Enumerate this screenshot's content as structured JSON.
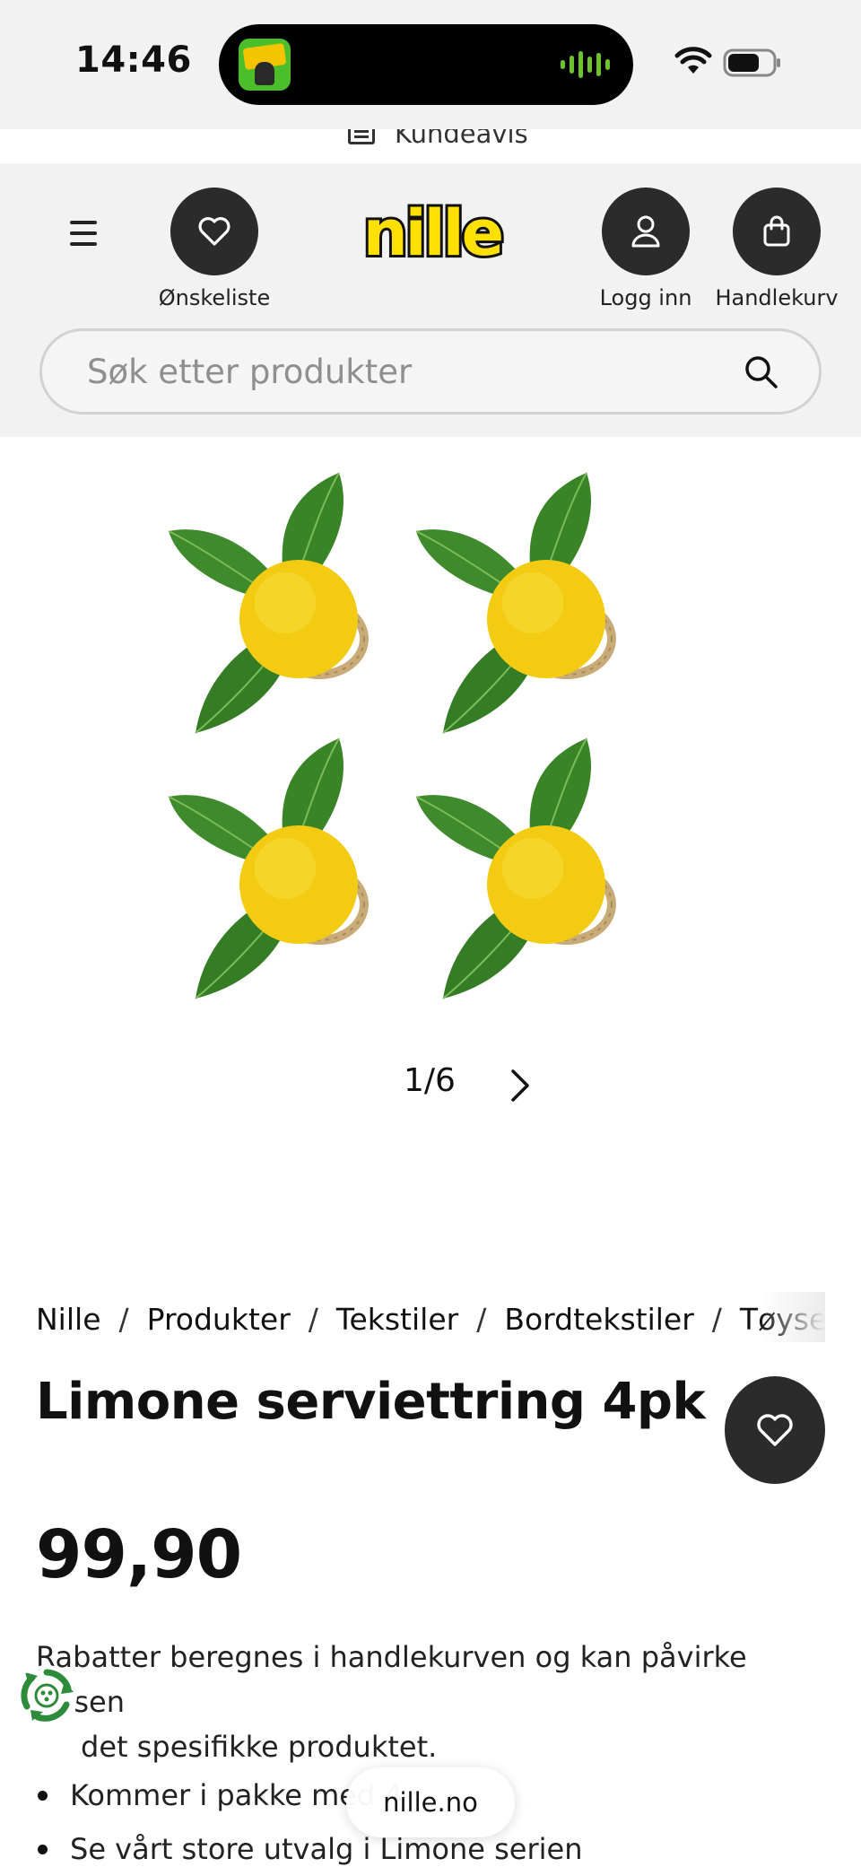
{
  "status_bar": {
    "time": "14:46"
  },
  "kundeavis": {
    "label": "Kundeavis"
  },
  "header": {
    "wishlist_label": "Ønskeliste",
    "login_label": "Logg inn",
    "cart_label": "Handlekurv",
    "logo_text": "nille",
    "brand_colors": {
      "logo_fill": "#ffe000",
      "logo_outline": "#111111",
      "dark_button": "#2b2b2b"
    }
  },
  "search": {
    "placeholder": "Søk etter produkter"
  },
  "gallery": {
    "pager": "1/6"
  },
  "breadcrumb": {
    "items": [
      "Nille",
      "Produkter",
      "Tekstiler",
      "Bordtekstiler",
      "Tøyservi"
    ]
  },
  "product": {
    "title": "Limone serviettring 4pk",
    "price": "99,90",
    "discount_note": "Rabatter beregnes i handlekurven og kan påvirke prisen på det spesifikke produktet.",
    "discount_visible": "Rabatter beregnes i handlekurven og kan påvirke prisen",
    "discount_visible_line2": "det spesifikke produktet.",
    "bullets": [
      "Kommer i pakke med 4",
      "Se vårt store utvalg i Limone serien"
    ]
  },
  "browser": {
    "url": "nille.no"
  },
  "icons": {
    "menu": "hamburger-icon",
    "wishlist": "heart-icon",
    "login": "user-icon",
    "cart": "shopping-bag-icon",
    "search": "search-icon",
    "next": "chevron-right-icon",
    "recycle": "recycle-icon"
  }
}
